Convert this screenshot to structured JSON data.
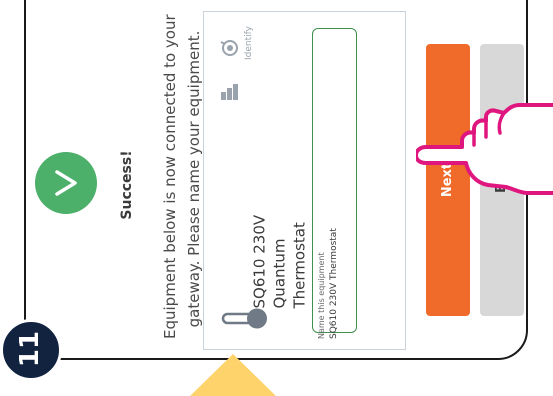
{
  "step": {
    "number": "11"
  },
  "dialog": {
    "title": "Success!",
    "description_line1": "Equipment below is now connected to your",
    "description_line2": "gateway. Please name your equipment."
  },
  "equipment": {
    "name_line1": "SQ610 230V",
    "name_line2": "Quantum",
    "name_line3": "Thermostat",
    "identify_label": "Identify",
    "name_field": {
      "label": "Name this equipment",
      "value": "SQ610 230V Thermostat"
    }
  },
  "buttons": {
    "next_label": "Next",
    "back_label": "B"
  },
  "colors": {
    "success_green": "#4caf6a",
    "next_orange": "#f06a2a",
    "field_border_green": "#3f8f4f",
    "badge_navy": "#11233f",
    "pointer_yellow": "#ffd36b",
    "hand_magenta": "#e0167f"
  },
  "icons": {
    "success": "checkmark-icon",
    "thermostat": "thermometer-icon",
    "signal": "signal-strength-icon",
    "identify": "identify-icon",
    "hand": "pointing-hand-icon"
  }
}
